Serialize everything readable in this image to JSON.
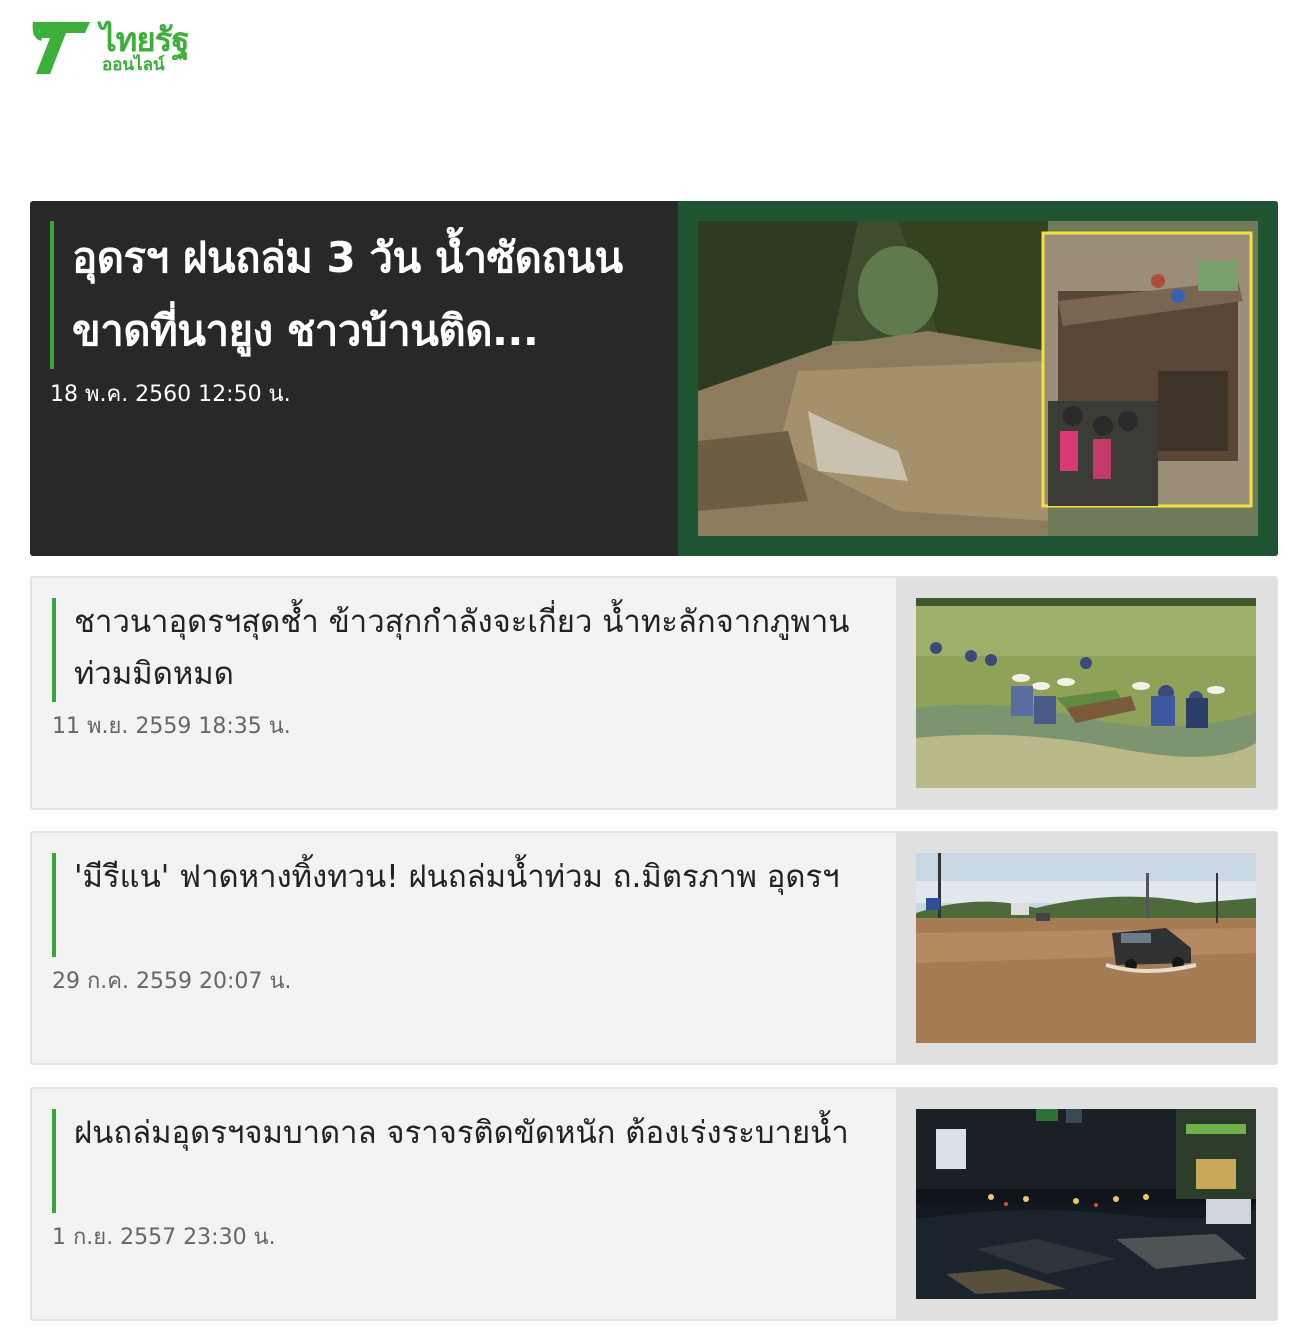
{
  "logo": {
    "main": "ไทยรัฐ",
    "sub": "ออนไลน์",
    "color": "#3cae3a"
  },
  "colors": {
    "accent": "#35a83a",
    "hero_bg": "#282828",
    "hero_image_frame": "#1f5533",
    "card_bg": "#f3f3f3"
  },
  "hero": {
    "title": "อุดรฯ ฝนถล่ม 3 วัน น้ำซัดถนนขาดที่นายูง ชาวบ้านติด...",
    "date": "18 พ.ค. 2560 12:50 น."
  },
  "articles": [
    {
      "title": "ชาวนาอุดรฯสุดช้ำ ข้าวสุกกำลังจะเกี่ยว น้ำทะลักจากภูพานท่วมมิดหมด",
      "date": "11 พ.ย. 2559 18:35 น."
    },
    {
      "title": "'มีรีแน' ฟาดหางทิ้งทวน! ฝนถล่มน้ำท่วม ถ.มิตรภาพ อุดรฯ",
      "date": "29 ก.ค. 2559 20:07 น."
    },
    {
      "title": "ฝนถล่มอุดรฯจมบาดาล จราจรติดขัดหนัก ต้องเร่งระบายน้ำ",
      "date": "1 ก.ย. 2557 23:30 น."
    }
  ]
}
